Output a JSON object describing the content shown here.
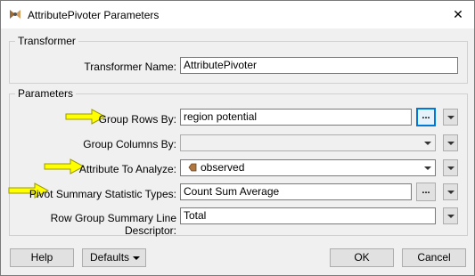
{
  "window": {
    "title": "AttributePivoter Parameters",
    "close_glyph": "✕"
  },
  "transformer": {
    "legend": "Transformer",
    "name_label": "Transformer Name:",
    "name_value": "AttributePivoter"
  },
  "parameters": {
    "legend": "Parameters",
    "rows": [
      {
        "label": "Group Rows By:",
        "value": "region potential",
        "browse": "...",
        "highlight": true
      },
      {
        "label": "Group Columns By:",
        "value": ""
      },
      {
        "label": "Attribute To Analyze:",
        "value": "observed",
        "value_icon": "attribute-icon"
      },
      {
        "label": "Pivot Summary Statistic Types:",
        "value": "Count Sum Average",
        "browse": "..."
      },
      {
        "label": "Row Group Summary Line Descriptor:",
        "value": "Total"
      }
    ]
  },
  "footer": {
    "help": "Help",
    "defaults": "Defaults",
    "ok": "OK",
    "cancel": "Cancel"
  },
  "colors": {
    "annotation_arrow": "#ffff00",
    "attribute_icon": "#b07840",
    "focus_blue": "#0078d7"
  },
  "icons": {
    "app": "fme-transformer-icon",
    "arrow": "yellow-arrow-icon"
  }
}
